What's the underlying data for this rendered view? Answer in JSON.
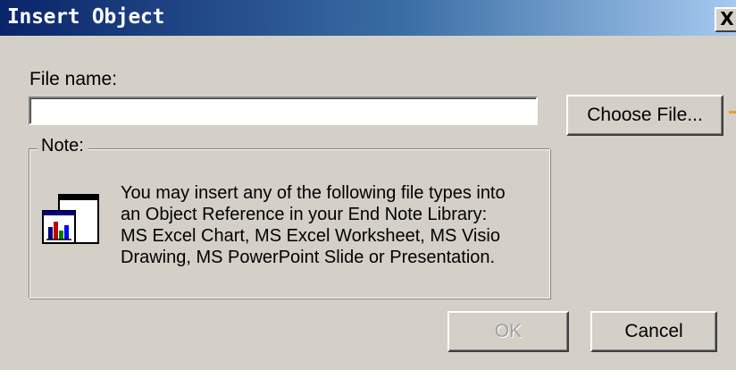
{
  "window": {
    "title": "Insert Object",
    "close_glyph": "X"
  },
  "file": {
    "label": "File name:",
    "value": "",
    "placeholder": ""
  },
  "choose_button": {
    "label": "Choose File..."
  },
  "note": {
    "legend": "Note:",
    "icon": "excel-chart-object-icon",
    "lines": [
      "You may insert any of the following file types into",
      "an Object Reference in your End Note Library:",
      "MS Excel Chart, MS Excel Worksheet, MS Visio",
      "Drawing, MS PowerPoint Slide or Presentation."
    ]
  },
  "buttons": {
    "ok": "OK",
    "ok_enabled": false,
    "cancel": "Cancel"
  },
  "colors": {
    "title_start": "#0a246a",
    "title_end": "#a6caf0",
    "face": "#d4d0c8",
    "indicator": "#e8a020"
  }
}
